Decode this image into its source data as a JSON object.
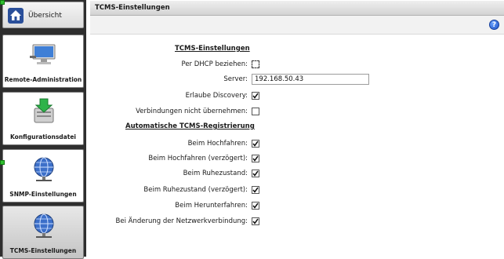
{
  "sidebar": {
    "home": {
      "label": "Übersicht"
    },
    "tiles": [
      {
        "label": "Remote-Administration",
        "icon": "monitor-icon"
      },
      {
        "label": "Konfigurationsdatei",
        "icon": "config-file-download-icon"
      },
      {
        "label": "SNMP-Einstellungen",
        "icon": "globe-network-icon"
      },
      {
        "label": "TCMS-Einstellungen",
        "icon": "globe-network-icon"
      }
    ]
  },
  "panel": {
    "title": "TCMS-Einstellungen",
    "help_icon": "help-icon"
  },
  "form": {
    "section1_heading": "TCMS-Einstellungen",
    "dhcp_label": "Per DHCP beziehen:",
    "dhcp_checked": false,
    "server_label": "Server:",
    "server_value": "192.168.50.43",
    "discovery_label": "Erlaube Discovery:",
    "discovery_checked": true,
    "no_takeover_label": "Verbindungen nicht übernehmen:",
    "no_takeover_checked": false,
    "section2_heading": "Automatische TCMS-Registrierung",
    "boot_label": "Beim Hochfahren:",
    "boot_checked": true,
    "boot_delayed_label": "Beim Hochfahren (verzögert):",
    "boot_delayed_checked": true,
    "standby_label": "Beim Ruhezustand:",
    "standby_checked": true,
    "standby_delayed_label": "Beim Ruhezustand (verzögert):",
    "standby_delayed_checked": true,
    "shutdown_label": "Beim Herunterfahren:",
    "shutdown_checked": true,
    "netchange_label": "Bei Änderung der Netzwerkverbindung:",
    "netchange_checked": true
  },
  "colors": {
    "sidebar_bg": "#2e2e2e",
    "check": "#111111",
    "selection_handle": "#2fbf2f"
  }
}
